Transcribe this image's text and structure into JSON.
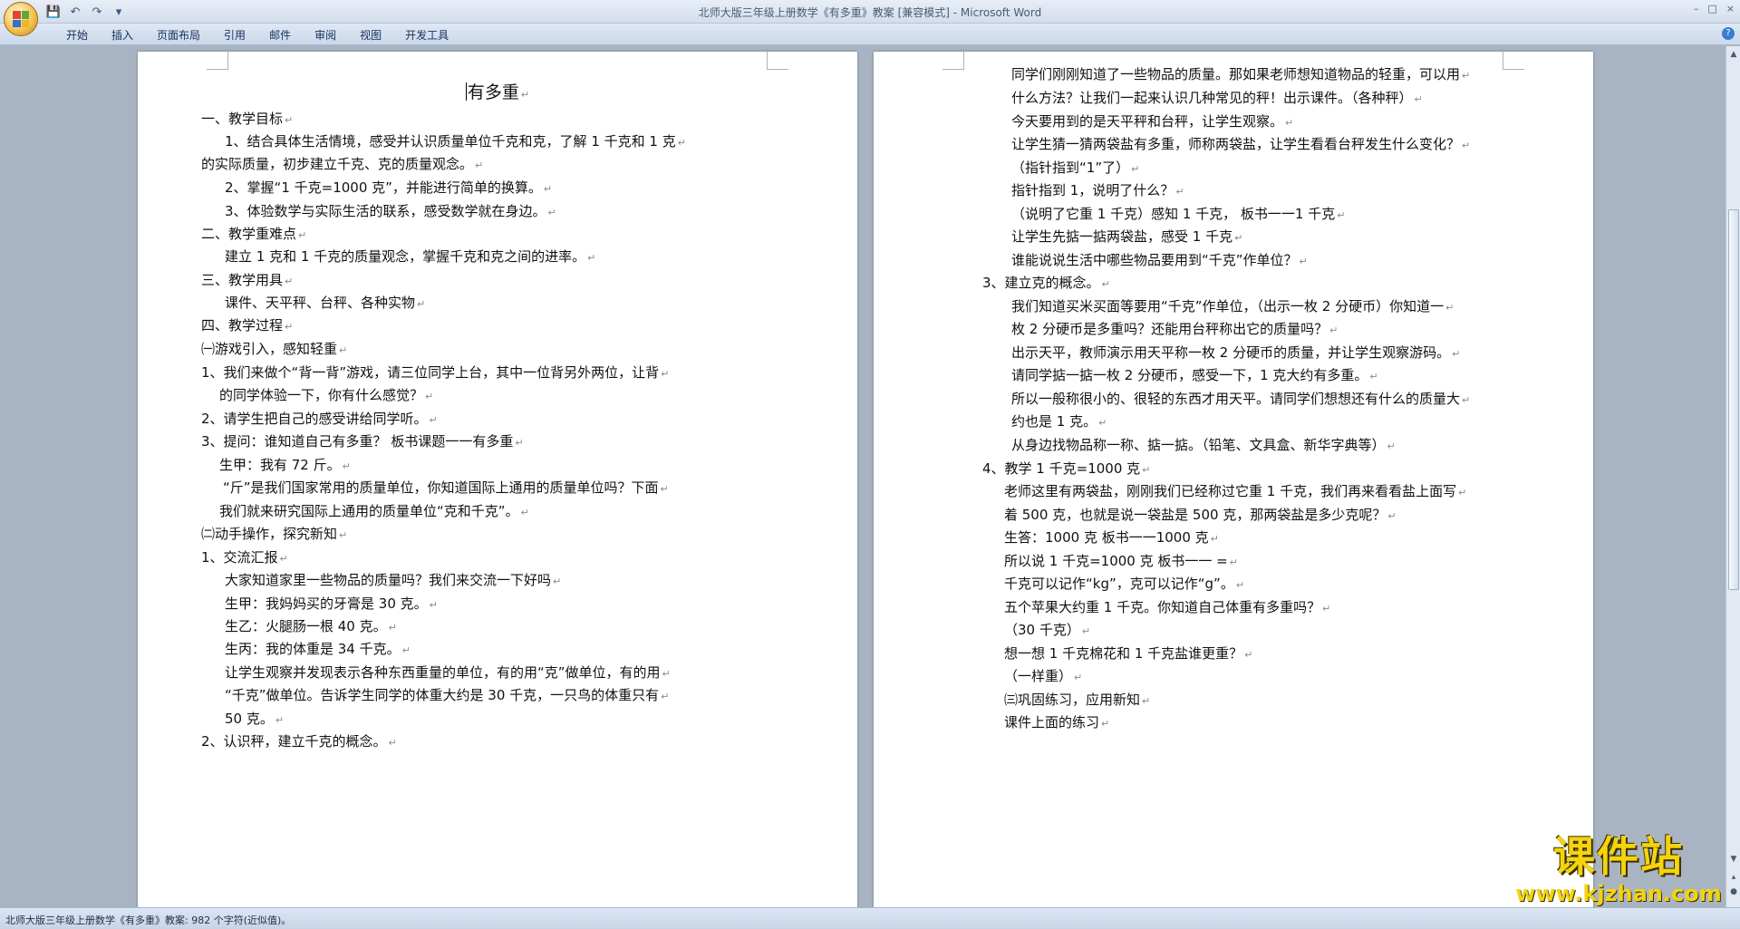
{
  "window": {
    "title": "北师大版三年级上册数学《有多重》教案 [兼容模式] - Microsoft Word",
    "controls": [
      "–",
      "□",
      "×"
    ]
  },
  "quick_access": {
    "save_icon": "save-icon",
    "undo_icon": "undo-icon",
    "redo_icon": "redo-icon"
  },
  "ribbon": {
    "tabs": [
      "开始",
      "插入",
      "页面布局",
      "引用",
      "邮件",
      "审阅",
      "视图",
      "开发工具"
    ]
  },
  "document": {
    "title": "有多重",
    "left_page_lines": [
      "一、教学目标",
      "1、结合具体生活情境，感受并认识质量单位千克和克，了解 1 千克和 1 克",
      "的实际质量，初步建立千克、克的质量观念。",
      "2、掌握“1 千克=1000 克”，并能进行简单的换算。",
      "3、体验数学与实际生活的联系，感受数学就在身边。",
      "二、教学重难点",
      "建立 1 克和 1 千克的质量观念，掌握千克和克之间的进率。",
      "三、教学用具",
      "课件、天平秤、台秤、各种实物",
      "四、教学过程",
      "㈠游戏引入，感知轻重",
      "1、我们来做个“背一背”游戏，请三位同学上台，其中一位背另外两位，让背",
      "的同学体验一下，你有什么感觉？",
      "2、请学生把自己的感受讲给同学听。",
      "3、提问：谁知道自己有多重？   板书课题一一有多重",
      "生甲：我有 72 斤。",
      "“斤”是我们国家常用的质量单位，你知道国际上通用的质量单位吗？下面",
      "我们就来研究国际上通用的质量单位“克和千克”。",
      "㈡动手操作，探究新知",
      "1、交流汇报",
      "大家知道家里一些物品的质量吗？我们来交流一下好吗",
      "生甲：我妈妈买的牙膏是 30 克。",
      "生乙：火腿肠一根 40 克。",
      "生丙：我的体重是 34 千克。",
      "让学生观察并发现表示各种东西重量的单位，有的用“克”做单位，有的用",
      "“千克”做单位。告诉学生同学的体重大约是 30 千克，一只鸟的体重只有",
      "50 克。",
      "2、认识秤，建立千克的概念。"
    ],
    "right_page_lines": [
      "同学们刚刚知道了一些物品的质量。那如果老师想知道物品的轻重，可以用",
      "什么方法？让我们一起来认识几种常见的秤！出示课件。（各种秤）",
      "今天要用到的是天平秤和台秤，让学生观察。",
      "让学生猜一猜两袋盐有多重，师称两袋盐，让学生看看台秤发生什么变化？",
      "（指针指到“1”了）",
      "指针指到 1，说明了什么？",
      "（说明了它重 1 千克）感知 1 千克，  板书一一1 千克",
      "让学生先掂一掂两袋盐，感受 1 千克",
      "谁能说说生活中哪些物品要用到“千克”作单位？",
      "3、建立克的概念。",
      "我们知道买米买面等要用“千克”作单位，（出示一枚 2 分硬币）你知道一",
      "枚 2 分硬币是多重吗？还能用台秤称出它的质量吗？",
      "出示天平，教师演示用天平称一枚 2 分硬币的质量，并让学生观察游码。",
      "请同学掂一掂一枚 2 分硬币，感受一下，1 克大约有多重。",
      "所以一般称很小的、很轻的东西才用天平。请同学们想想还有什么的质量大",
      "约也是 1 克。",
      "从身边找物品称一称、掂一掂。（铅笔、文具盒、新华字典等）",
      "4、教学 1 千克=1000 克",
      "老师这里有两袋盐，刚刚我们已经称过它重 1 千克，我们再来看看盐上面写",
      "着 500 克，也就是说一袋盐是 500 克，那两袋盐是多少克呢？",
      "生答：1000 克   板书一一1000 克",
      "所以说 1 千克=1000 克   板书一一 =",
      "千克可以记作“kg”，克可以记作“g”。",
      "五个苹果大约重 1 千克。你知道自己体重有多重吗？",
      "（30 千克）",
      "想一想 1 千克棉花和 1 千克盐谁更重？",
      "（一样重）",
      "㈢巩固练习，应用新知",
      "课件上面的练习"
    ],
    "paragraph_mark": "↵"
  },
  "status_bar": {
    "text": "北师大版三年级上册数学《有多重》教案: 982 个字符(近似值)。"
  },
  "watermark": {
    "main": "课件站",
    "sub": "www.kjzhan.com",
    "color": "#f3d40d"
  }
}
